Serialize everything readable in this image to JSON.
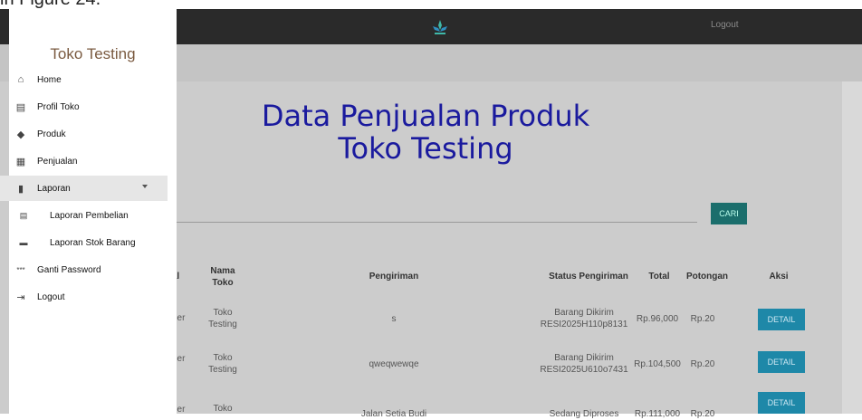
{
  "caption": "in Figure 24.",
  "topbar": {
    "logout": "Logout"
  },
  "page": {
    "title_line1": "Data Penjualan Produk",
    "title_line2": "Toko Testing",
    "cari": "CARI"
  },
  "table": {
    "headers": {
      "col1_partial": "al",
      "nama_toko": "Nama Toko",
      "pengiriman": "Pengiriman",
      "status": "Status Pengiriman",
      "total": "Total",
      "potongan": "Potongan",
      "aksi": "Aksi"
    },
    "rows": [
      {
        "col1": "ber",
        "toko": "Toko Testing",
        "pengiriman": "s",
        "status1": "Barang Dikirim",
        "status2": "RESI2025H110p8131",
        "total": "Rp.96,000",
        "potongan": "Rp.20",
        "aksi": "DETAIL"
      },
      {
        "col1": "ber",
        "toko": "Toko Testing",
        "pengiriman": "qweqwewqe",
        "status1": "Barang Dikirim",
        "status2": "RESI2025U610o7431",
        "total": "Rp.104,500",
        "potongan": "Rp.20",
        "aksi": "DETAIL"
      },
      {
        "col1": "ber",
        "toko": "Toko",
        "pengiriman": "Jalan Setia Budi",
        "status1": "Sedang Diproses",
        "status2": "",
        "total": "Rp.111,000",
        "potongan": "Rp.20",
        "aksi": "DETAIL"
      }
    ]
  },
  "sidebar": {
    "brand": "Toko Testing",
    "items": [
      {
        "label": "Home",
        "icon": "home-icon",
        "glyph": "⌂"
      },
      {
        "label": "Profil Toko",
        "icon": "store-icon",
        "glyph": "▤"
      },
      {
        "label": "Produk",
        "icon": "tag-icon",
        "glyph": "◆"
      },
      {
        "label": "Penjualan",
        "icon": "clipboard-icon",
        "glyph": "▦"
      },
      {
        "label": "Laporan",
        "icon": "file-icon",
        "glyph": "▮"
      },
      {
        "label": "Laporan Pembelian",
        "icon": "receipt-icon",
        "glyph": "▤"
      },
      {
        "label": "Laporan Stok Barang",
        "icon": "archive-icon",
        "glyph": "▬"
      },
      {
        "label": "Ganti Password",
        "icon": "password-icon",
        "glyph": "***"
      },
      {
        "label": "Logout",
        "icon": "logout-icon",
        "glyph": "⇥"
      }
    ]
  }
}
